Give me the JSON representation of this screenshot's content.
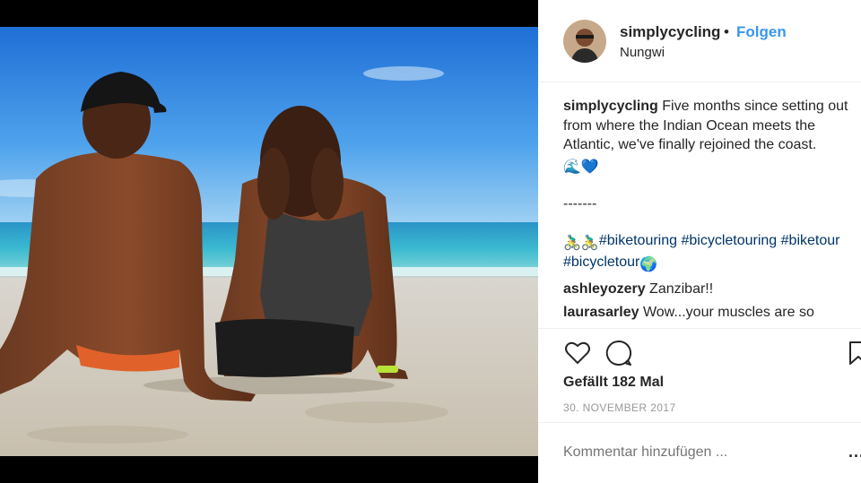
{
  "post": {
    "username": "simplycycling",
    "separator": "•",
    "follow_label": "Folgen",
    "location": "Nungwi",
    "photo_description_icon": "beach-couple-photo"
  },
  "caption": {
    "username": "simplycycling",
    "text": " Five months since setting out from where the Indian Ocean meets the Atlantic, we've finally rejoined the coast. ",
    "emojis": "🌊💙",
    "dashes": "-------",
    "hashtag_prefix_emojis": "🚴‍♂️🚴‍♂️ ",
    "hashtags": [
      "#biketouring",
      "#bicycletouring",
      "#biketour",
      "#bicycletour"
    ],
    "hashtag_suffix_emoji": " 🌍"
  },
  "comments": [
    {
      "username": "ashleyozery",
      "text": " Zanzibar!!"
    },
    {
      "username": "laurasarley",
      "text": " Wow...your muscles are so"
    }
  ],
  "actions": {
    "like_icon": "heart-outline-icon",
    "comment_icon": "speech-bubble-icon",
    "save_icon": "bookmark-icon"
  },
  "likes_text": "Gefällt 182 Mal",
  "date_text": "30. NOVEMBER 2017",
  "comment_placeholder": "Kommentar hinzufügen ...",
  "more_label": "...",
  "colors": {
    "link_blue": "#3897f0",
    "hashtag_blue": "#003569",
    "text": "#262626",
    "muted": "#999999"
  }
}
